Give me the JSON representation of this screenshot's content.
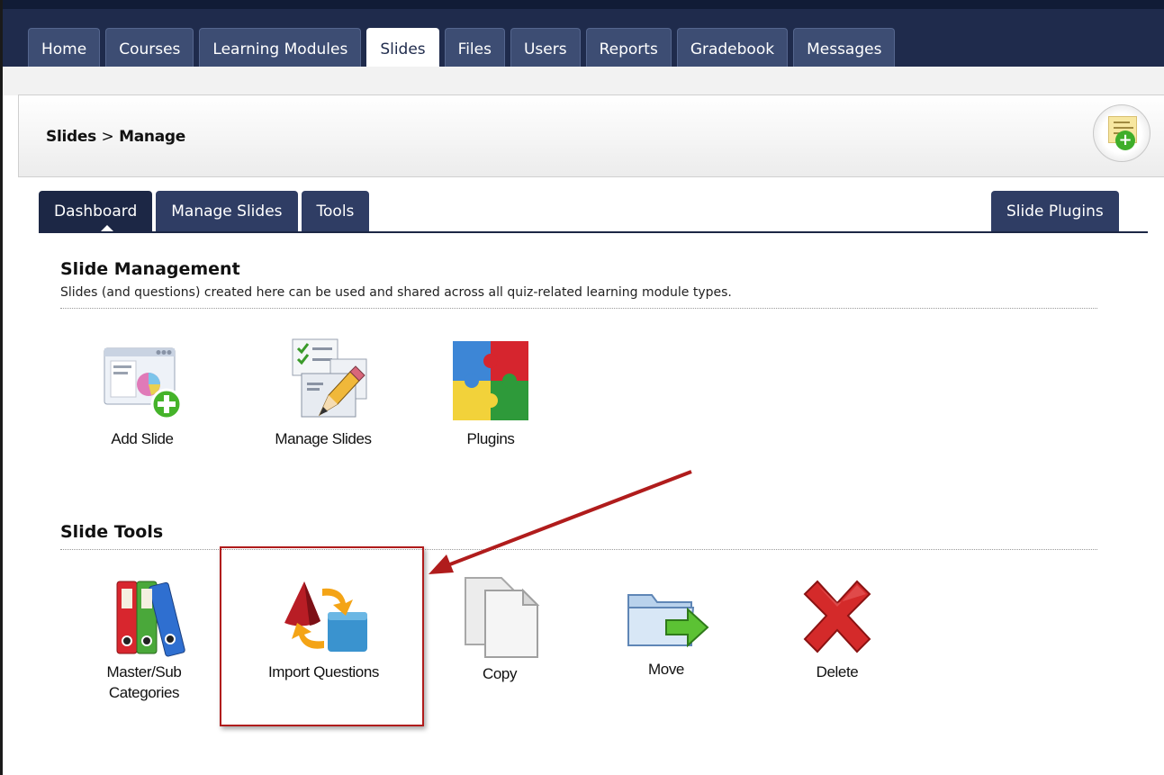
{
  "top_nav": {
    "tabs": [
      {
        "label": "Home",
        "active": false
      },
      {
        "label": "Courses",
        "active": false
      },
      {
        "label": "Learning Modules",
        "active": false
      },
      {
        "label": "Slides",
        "active": true
      },
      {
        "label": "Files",
        "active": false
      },
      {
        "label": "Users",
        "active": false
      },
      {
        "label": "Reports",
        "active": false
      },
      {
        "label": "Gradebook",
        "active": false
      },
      {
        "label": "Messages",
        "active": false
      }
    ]
  },
  "header": {
    "breadcrumb_root": "Slides",
    "breadcrumb_sep": ">",
    "breadcrumb_current": "Manage"
  },
  "sub_tabs": {
    "tabs": [
      {
        "label": "Dashboard",
        "active": true
      },
      {
        "label": "Manage Slides",
        "active": false
      },
      {
        "label": "Tools",
        "active": false
      }
    ],
    "right_tab": "Slide Plugins"
  },
  "slide_management": {
    "title": "Slide Management",
    "description": "Slides (and questions) created here can be used and shared across all quiz-related learning module types.",
    "items": [
      {
        "label": "Add Slide",
        "icon": "add-slide-icon"
      },
      {
        "label": "Manage Slides",
        "icon": "manage-slides-icon"
      },
      {
        "label": "Plugins",
        "icon": "puzzle-plugins-icon"
      }
    ]
  },
  "slide_tools": {
    "title": "Slide Tools",
    "items": [
      {
        "label": "Master/Sub Categories",
        "line1": "Master/Sub",
        "line2": "Categories",
        "icon": "binders-icon"
      },
      {
        "label": "Import Questions",
        "icon": "import-questions-icon"
      },
      {
        "label": "Copy",
        "icon": "copy-icon"
      },
      {
        "label": "Move",
        "icon": "move-folder-icon"
      },
      {
        "label": "Delete",
        "icon": "delete-x-icon"
      }
    ]
  },
  "colors": {
    "nav_bg": "#1f2b4c",
    "tab_bg": "#3d4d73",
    "subtab_bg": "#2f3d64",
    "highlight": "#b01c1c"
  }
}
